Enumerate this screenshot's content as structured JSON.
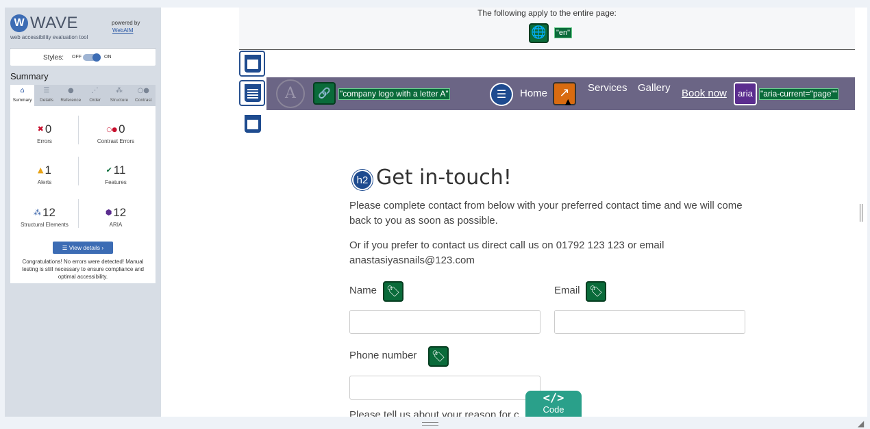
{
  "wave": {
    "logo_mark": "W",
    "title": "WAVE",
    "tagline": "web accessibility evaluation tool",
    "powered_by": "powered by",
    "webaim": "WebAIM",
    "styles_label": "Styles:",
    "styles_off": "OFF",
    "styles_on": "ON",
    "summary_heading": "Summary",
    "tabs": [
      {
        "label": "Summary",
        "icon": "home-icon",
        "glyph": "⌂"
      },
      {
        "label": "Details",
        "icon": "list-icon",
        "glyph": "☰"
      },
      {
        "label": "Reference",
        "icon": "info-icon",
        "glyph": "●"
      },
      {
        "label": "Order",
        "icon": "order-icon",
        "glyph": "⋰"
      },
      {
        "label": "Structure",
        "icon": "structure-icon",
        "glyph": "⁂"
      },
      {
        "label": "Contrast",
        "icon": "contrast-icon",
        "glyph": "○●"
      }
    ],
    "stats": {
      "errors": {
        "value": "0",
        "label": "Errors",
        "glyph": "✖",
        "color": "#c8102e"
      },
      "contrast_errors": {
        "value": "0",
        "label": "Contrast Errors",
        "glyph": "○●",
        "color": "#c8102e"
      },
      "alerts": {
        "value": "1",
        "label": "Alerts",
        "glyph": "▲",
        "color": "#e8a317"
      },
      "features": {
        "value": "11",
        "label": "Features",
        "glyph": "✔",
        "color": "#0a6b3a"
      },
      "structural": {
        "value": "12",
        "label": "Structural Elements",
        "glyph": "⁂",
        "color": "#2957a4"
      },
      "aria": {
        "value": "12",
        "label": "ARIA",
        "glyph": "⬢",
        "color": "#5b2d8f"
      }
    },
    "view_details": "☰  View details ›",
    "congrats": "Congratulations! No errors were detected! Manual testing is still necessary to ensure compliance and optimal accessibility."
  },
  "page": {
    "apply_text": "The following apply to the entire page:",
    "lang_tag": "\"en\"",
    "logo_letter": "A",
    "logo_alt": "\"company logo with a letter A\"",
    "nav": {
      "home": "Home",
      "services": "Services",
      "gallery": "Gallery",
      "book_now": "Book now",
      "aria_badge": "aria",
      "aria_current": "\"aria-current=\"page\"\""
    },
    "h2_badge": "h2",
    "heading": "Get in-touch!",
    "para1": "Please complete contact from below with your preferred contact time and we will come back to you as soon as possible.",
    "para2": "Or if you prefer to contact us direct call us on 01792 123 123 or email anastasiyasnails@123.com",
    "labels": {
      "name": "Name",
      "email": "Email",
      "phone": "Phone number",
      "reason": "Please tell us about your reason for c"
    },
    "code_glyph": "</>",
    "code_label": "Code"
  }
}
